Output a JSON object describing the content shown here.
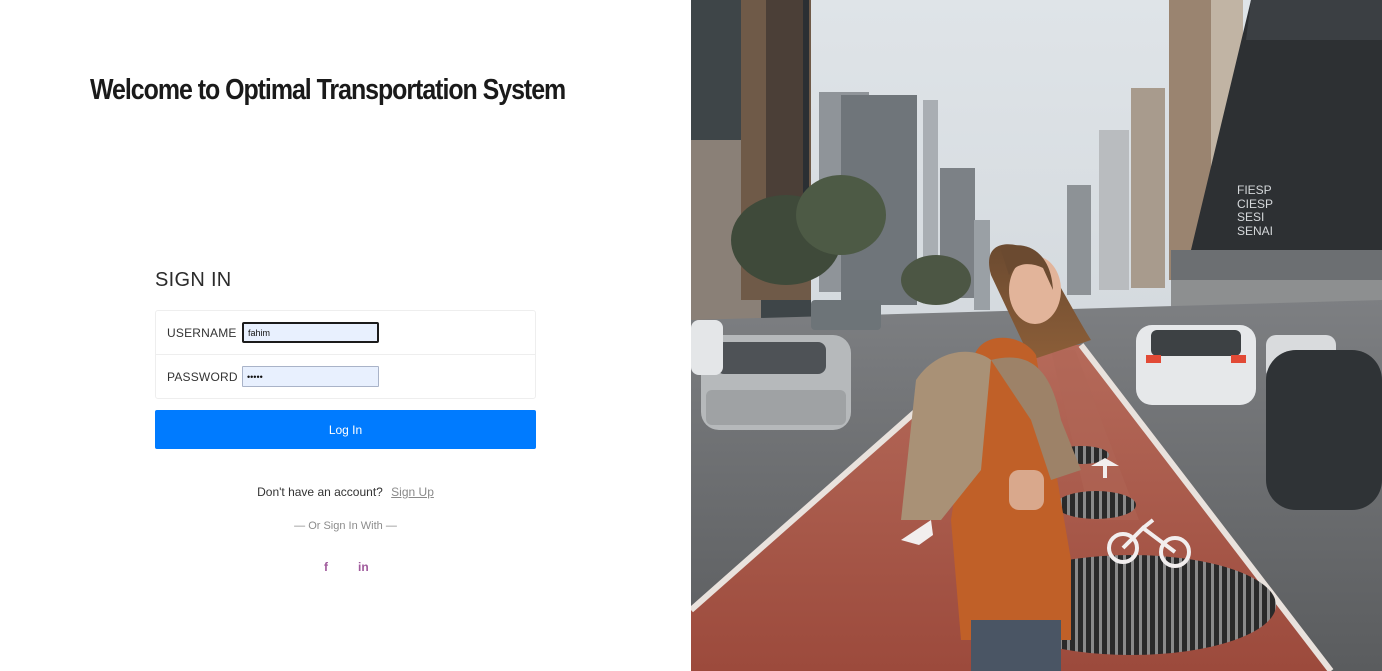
{
  "header": {
    "title": "Welcome to Optimal Transportation System"
  },
  "signin": {
    "title": "SIGN IN",
    "username_label": "USERNAME",
    "username_value": "fahim",
    "password_label": "PASSWORD",
    "password_value": "•••••",
    "login_label": "Log In",
    "no_account_text": "Don't have an account?",
    "signup_link": "Sign Up",
    "or_text": "— Or Sign In With —"
  },
  "social": {
    "facebook": "f",
    "linkedin": "in"
  },
  "colors": {
    "primary": "#007bff",
    "social": "#a05a9c",
    "input_bg": "#e8f0fe"
  },
  "hero": {
    "signs": [
      "FIESP",
      "CIESP",
      "SESI",
      "SENAI"
    ]
  }
}
